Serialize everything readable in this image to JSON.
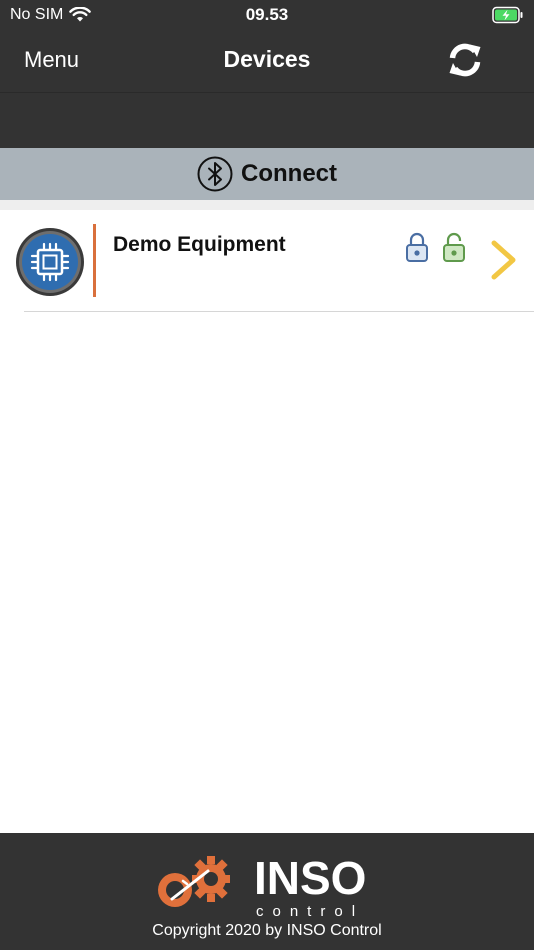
{
  "status_bar": {
    "carrier": "No SIM",
    "time": "09.53",
    "wifi_icon": "wifi-icon",
    "battery_icon": "battery-charging-icon"
  },
  "nav": {
    "menu_label": "Menu",
    "title": "Devices",
    "refresh_icon": "refresh-icon"
  },
  "connect": {
    "label": "Connect",
    "icon": "bluetooth-icon"
  },
  "devices": [
    {
      "name": "Demo Equipment",
      "icon": "chip-icon",
      "status_icons": [
        "lock-closed-icon",
        "lock-open-icon"
      ],
      "action_icon": "chevron-right-icon"
    }
  ],
  "footer": {
    "logo_text": "INSO",
    "logo_subtext": "control",
    "copyright": "Copyright 2020 by INSO Control"
  },
  "colors": {
    "bar_background": "#333333",
    "connect_bar": "#aab3ba",
    "chip_blue": "#2f6db0",
    "accent_orange": "#d9703c",
    "lock_blue": "#4a6ea3",
    "lock_green": "#7fb86a",
    "chevron_yellow": "#f2c744"
  }
}
